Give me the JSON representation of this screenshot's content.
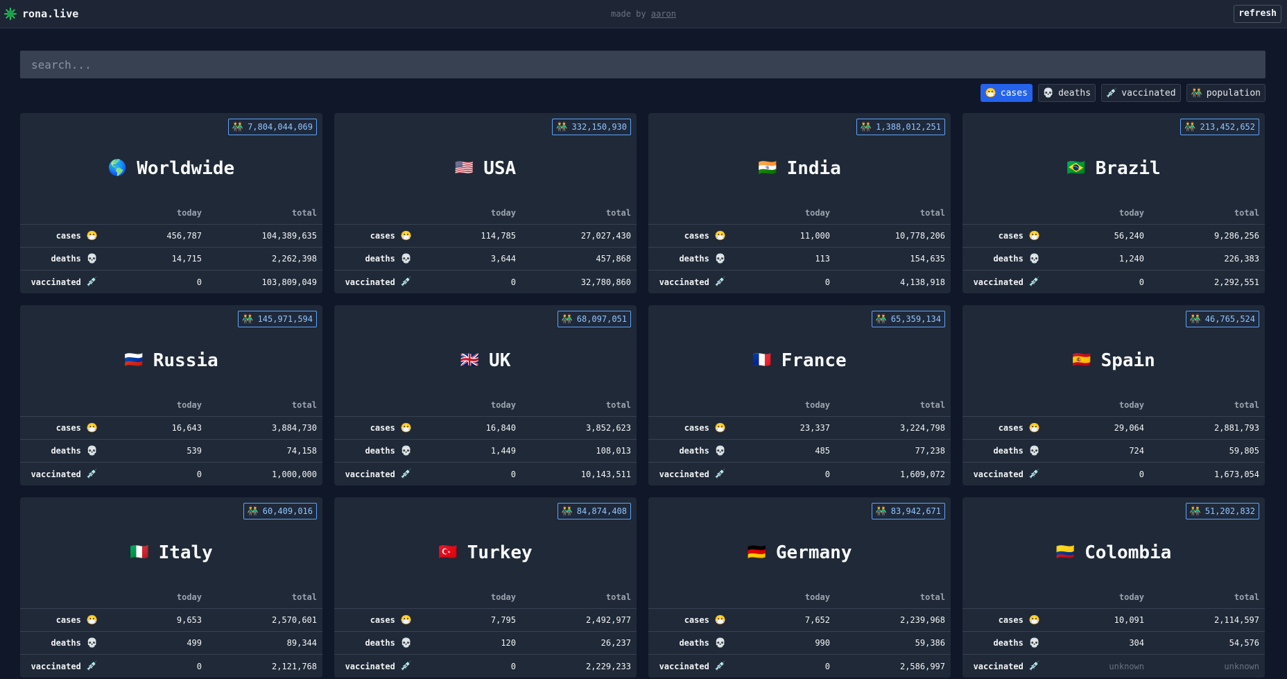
{
  "header": {
    "brand": "rona.live",
    "made_by_prefix": "made by",
    "author": "aaron",
    "refresh_label": "refresh"
  },
  "search": {
    "placeholder": "search..."
  },
  "sort": {
    "active": "cases",
    "options": [
      {
        "icon": "😷",
        "label": "cases"
      },
      {
        "icon": "💀",
        "label": "deaths"
      },
      {
        "icon": "💉",
        "label": "vaccinated"
      },
      {
        "icon": "👬",
        "label": "population"
      }
    ]
  },
  "table_headers": {
    "today": "today",
    "total": "total"
  },
  "row_labels": {
    "cases": {
      "label": "cases",
      "icon": "😷"
    },
    "deaths": {
      "label": "deaths",
      "icon": "💀"
    },
    "vaccinated": {
      "label": "vaccinated",
      "icon": "💉"
    }
  },
  "population_icon": "👬",
  "countries": [
    {
      "flag": "🌎",
      "name": "Worldwide",
      "population": "7,804,044,069",
      "cases": [
        "456,787",
        "104,389,635"
      ],
      "deaths": [
        "14,715",
        "2,262,398"
      ],
      "vaccinated": [
        "0",
        "103,809,049"
      ]
    },
    {
      "flag": "🇺🇸",
      "name": "USA",
      "population": "332,150,930",
      "cases": [
        "114,785",
        "27,027,430"
      ],
      "deaths": [
        "3,644",
        "457,868"
      ],
      "vaccinated": [
        "0",
        "32,780,860"
      ]
    },
    {
      "flag": "🇮🇳",
      "name": "India",
      "population": "1,388,012,251",
      "cases": [
        "11,000",
        "10,778,206"
      ],
      "deaths": [
        "113",
        "154,635"
      ],
      "vaccinated": [
        "0",
        "4,138,918"
      ]
    },
    {
      "flag": "🇧🇷",
      "name": "Brazil",
      "population": "213,452,652",
      "cases": [
        "56,240",
        "9,286,256"
      ],
      "deaths": [
        "1,240",
        "226,383"
      ],
      "vaccinated": [
        "0",
        "2,292,551"
      ]
    },
    {
      "flag": "🇷🇺",
      "name": "Russia",
      "population": "145,971,594",
      "cases": [
        "16,643",
        "3,884,730"
      ],
      "deaths": [
        "539",
        "74,158"
      ],
      "vaccinated": [
        "0",
        "1,000,000"
      ]
    },
    {
      "flag": "🇬🇧",
      "name": "UK",
      "population": "68,097,051",
      "cases": [
        "16,840",
        "3,852,623"
      ],
      "deaths": [
        "1,449",
        "108,013"
      ],
      "vaccinated": [
        "0",
        "10,143,511"
      ]
    },
    {
      "flag": "🇫🇷",
      "name": "France",
      "population": "65,359,134",
      "cases": [
        "23,337",
        "3,224,798"
      ],
      "deaths": [
        "485",
        "77,238"
      ],
      "vaccinated": [
        "0",
        "1,609,072"
      ]
    },
    {
      "flag": "🇪🇸",
      "name": "Spain",
      "population": "46,765,524",
      "cases": [
        "29,064",
        "2,881,793"
      ],
      "deaths": [
        "724",
        "59,805"
      ],
      "vaccinated": [
        "0",
        "1,673,054"
      ]
    },
    {
      "flag": "🇮🇹",
      "name": "Italy",
      "population": "60,409,016",
      "cases": [
        "9,653",
        "2,570,601"
      ],
      "deaths": [
        "499",
        "89,344"
      ],
      "vaccinated": [
        "0",
        "2,121,768"
      ]
    },
    {
      "flag": "🇹🇷",
      "name": "Turkey",
      "population": "84,874,408",
      "cases": [
        "7,795",
        "2,492,977"
      ],
      "deaths": [
        "120",
        "26,237"
      ],
      "vaccinated": [
        "0",
        "2,229,233"
      ]
    },
    {
      "flag": "🇩🇪",
      "name": "Germany",
      "population": "83,942,671",
      "cases": [
        "7,652",
        "2,239,968"
      ],
      "deaths": [
        "990",
        "59,386"
      ],
      "vaccinated": [
        "0",
        "2,586,997"
      ]
    },
    {
      "flag": "🇨🇴",
      "name": "Colombia",
      "population": "51,202,832",
      "cases": [
        "10,091",
        "2,114,597"
      ],
      "deaths": [
        "304",
        "54,576"
      ],
      "vaccinated": [
        "unknown",
        "unknown"
      ]
    }
  ],
  "colors": {
    "background": "#0f1729",
    "card": "#1f2937",
    "accent": "#2563eb",
    "badge": "#60a5fa"
  }
}
